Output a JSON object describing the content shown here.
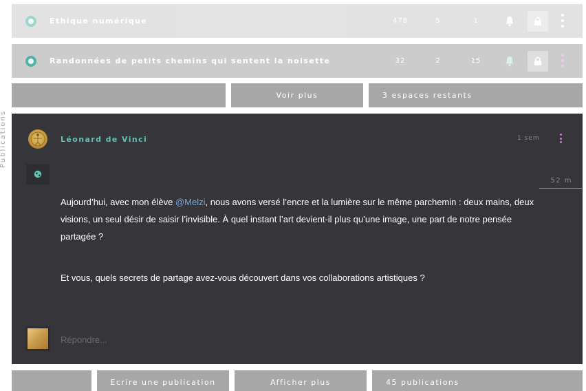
{
  "spaces": [
    {
      "name": "Ethique numérique",
      "stats": [
        "478",
        "5",
        "1"
      ],
      "faded": true
    },
    {
      "name": "Randonnées de petits chemins qui sentent la noisette",
      "stats": [
        "32",
        "2",
        "15"
      ],
      "faded": false
    }
  ],
  "spaces_footer": {
    "more_label": "Voir plus",
    "remaining_label": "3 espaces restants"
  },
  "side_label": "Publications",
  "post": {
    "author": "Léonard de Vinci",
    "time_ago": "1 sem",
    "read_time": "52 m",
    "paragraph1_before": "Aujourd’hui, avec mon élève ",
    "mention": "@Melzi",
    "paragraph1_after": ", nous avons versé l’encre et la lumière sur le même parchemin : deux mains, deux visions, un seul désir de saisir l’invisible. À quel instant l’art devient-il plus qu’une image, une part de notre pensée partagée ?",
    "paragraph2": "Et vous, quels secrets de partage avez-vous découvert dans vos collaborations artistiques ?",
    "reply_placeholder": "Répondre..."
  },
  "posts_footer": {
    "write_label": "Ecrire une publication",
    "show_more_label": "Afficher plus",
    "count_label": "45 publications"
  },
  "colors": {
    "accent": "#4fb3a9",
    "mention": "#6fa8dc",
    "kebab": "#d27bd0",
    "card": "#363539",
    "row": "#cccccc"
  }
}
